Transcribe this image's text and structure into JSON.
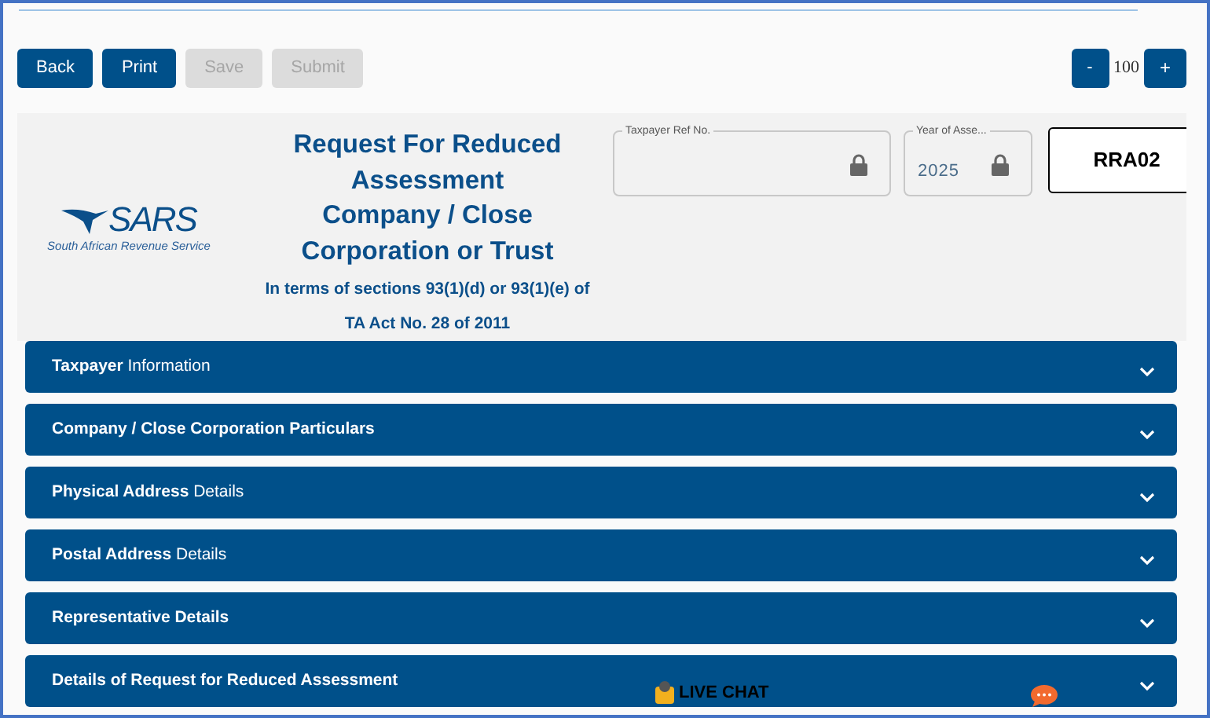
{
  "toolbar": {
    "buttons": [
      {
        "label": "Back",
        "disabled": false
      },
      {
        "label": "Print",
        "disabled": false
      },
      {
        "label": "Save",
        "disabled": true
      },
      {
        "label": "Submit",
        "disabled": true
      }
    ]
  },
  "zoom": {
    "decrease": "-",
    "value": "100",
    "increase": "+"
  },
  "header": {
    "logo": {
      "wordmark": "SARS",
      "tagline": "South African Revenue Service"
    },
    "title_lines": [
      "Request For Reduced",
      "Assessment",
      "Company / Close",
      "Corporation or Trust"
    ],
    "subtitle_lines": [
      "In terms of sections 93(1)(d) or 93(1)(e) of",
      "TA Act No. 28 of 2011"
    ],
    "fields": [
      {
        "label": "Taxpayer Ref No.",
        "locked": true
      },
      {
        "label": "Year of Asse...",
        "value": "2025",
        "locked": true
      }
    ],
    "form_code": "RRA02"
  },
  "sections": [
    {
      "label": "**Taxpayer** Information",
      "bold": false,
      "expanded": false
    },
    {
      "label": "Company / Close Corporation Particulars",
      "bold": true,
      "expanded": false
    },
    {
      "label": "**Physical Address** Details",
      "bold": false,
      "expanded": false
    },
    {
      "label": "**Postal Address** Details",
      "bold": false,
      "expanded": false
    },
    {
      "label": "Representative Details",
      "bold": true,
      "expanded": false
    },
    {
      "label": "Details of Request for Reduced Assessment",
      "bold": true,
      "expanded": false
    }
  ],
  "live_chat": {
    "label": "LIVE CHAT"
  }
}
